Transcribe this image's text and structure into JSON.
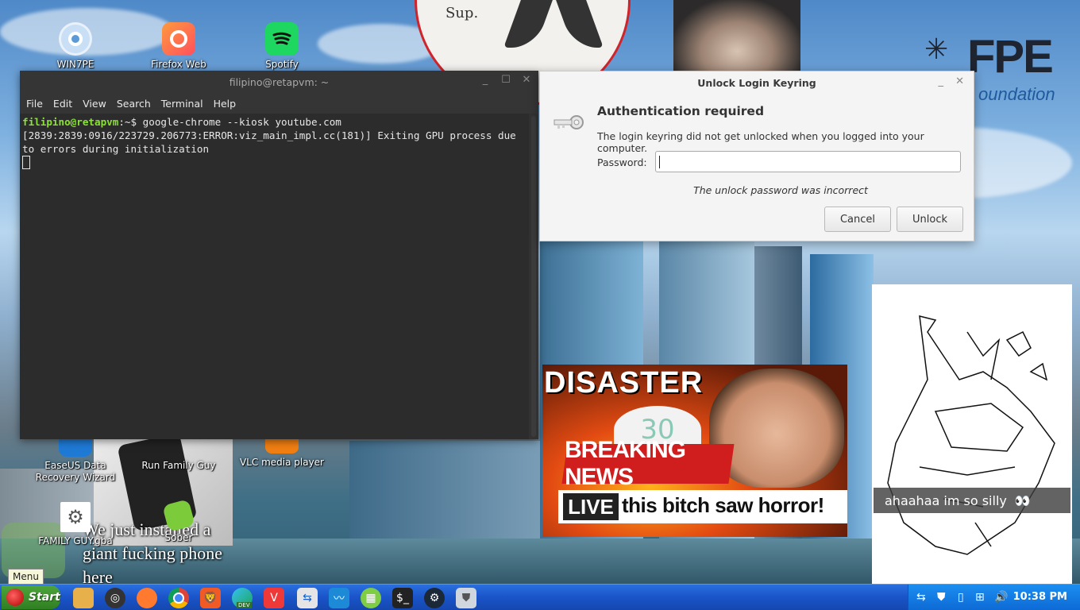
{
  "desktop": {
    "icons": [
      {
        "label": "WIN7PE",
        "icon": "disc-icon"
      },
      {
        "label": "Firefox Web",
        "icon": "firefox-icon"
      },
      {
        "label": "Spotify",
        "icon": "spotify-icon"
      },
      {
        "label": "EaseUS Data Recovery Wizard",
        "icon": "recovery-icon"
      },
      {
        "label": "Run Family Guy",
        "icon": "script-icon"
      },
      {
        "label": "VLC media player",
        "icon": "vlc-icon"
      },
      {
        "label": "FAMILY GUY.gba",
        "icon": "gear-file-icon"
      },
      {
        "label": "Sober",
        "icon": "sober-icon"
      }
    ],
    "wallpaper_texts": {
      "sticker_text": "Sup.",
      "logo_text": "FPE",
      "logo_sub": "oundation",
      "disaster_title": "DISASTER",
      "disaster_number": "30",
      "breaking_news": "BREAKING NEWS",
      "live": "LIVE",
      "ticker": "this bitch saw horror!",
      "sketch_caption": "ahaahaa im so silly",
      "phone_caption": "We just installed a giant fucking phone here"
    }
  },
  "terminal": {
    "title": "filipino@retapvm: ~",
    "menu": [
      "File",
      "Edit",
      "View",
      "Search",
      "Terminal",
      "Help"
    ],
    "prompt_user": "filipino@retapvm",
    "prompt_rest": ":~$ google-chrome --kiosk youtube.com",
    "output": "[2839:2839:0916/223729.206773:ERROR:viz_main_impl.cc(181)] Exiting GPU process due to errors during initialization"
  },
  "dialog": {
    "title": "Unlock Login Keyring",
    "heading": "Authentication required",
    "message": "The login keyring did not get unlocked when you logged into your computer.",
    "password_label": "Password:",
    "password_value": "",
    "error": "The unlock password was incorrect",
    "cancel": "Cancel",
    "unlock": "Unlock"
  },
  "taskbar": {
    "start_label": "Start",
    "menu_tooltip": "Menu",
    "apps": [
      "files-icon",
      "obs-icon",
      "firefox-icon",
      "chrome-icon",
      "brave-icon",
      "edge-dev-icon",
      "vivaldi-icon",
      "remote-icon",
      "monitor-icon",
      "calculator-icon",
      "terminal-icon",
      "steam-icon",
      "shield-icon"
    ],
    "edge_badge": "DEV",
    "clock": "10:38 PM"
  }
}
